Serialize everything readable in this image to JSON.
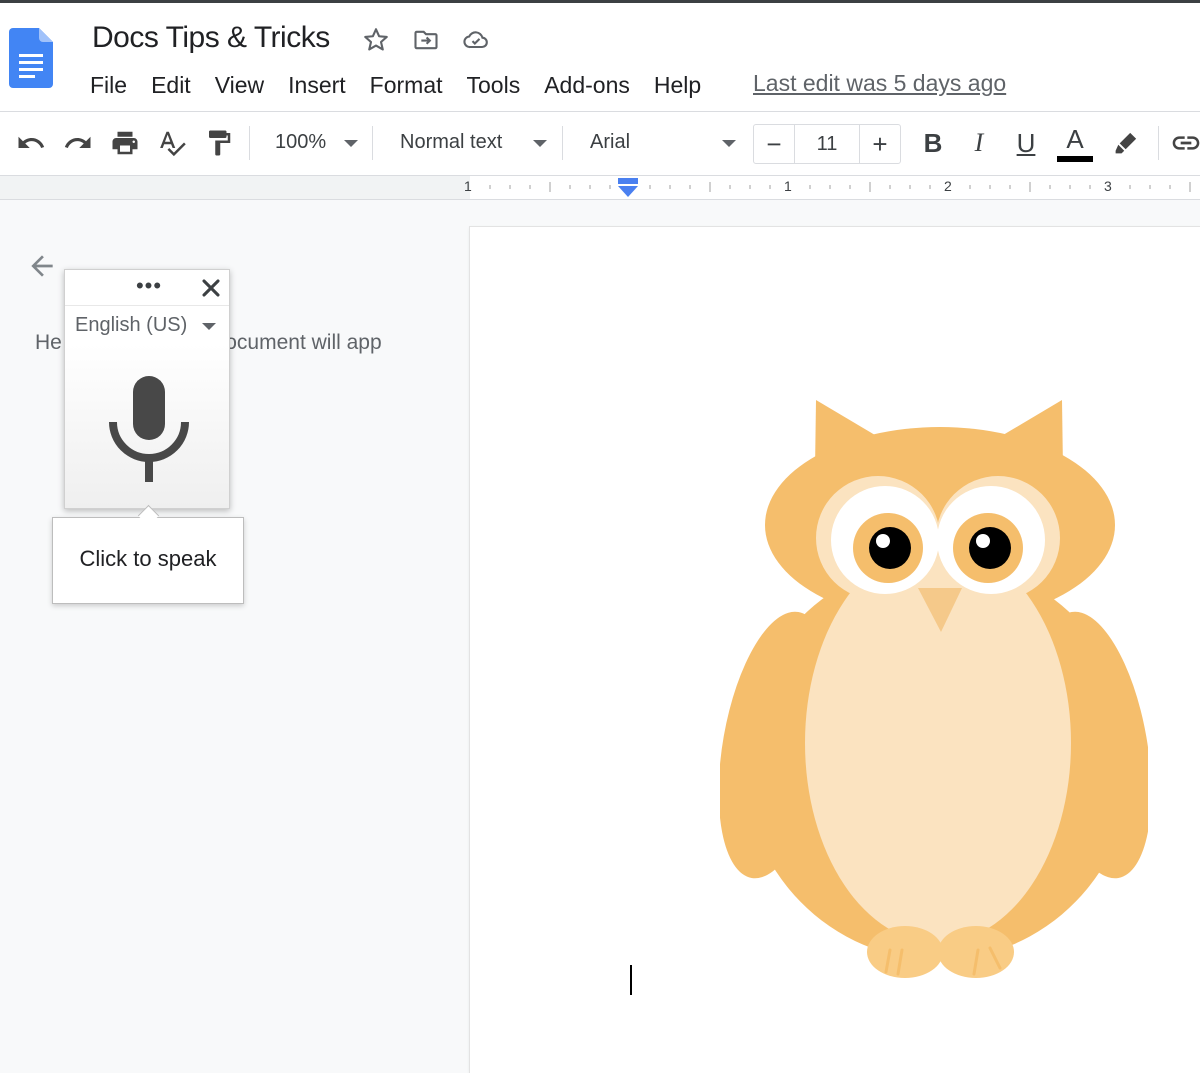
{
  "header": {
    "title": "Docs Tips & Tricks",
    "menu": [
      "File",
      "Edit",
      "View",
      "Insert",
      "Format",
      "Tools",
      "Add-ons",
      "Help"
    ],
    "last_edit": "Last edit was 5 days ago"
  },
  "toolbar": {
    "zoom": "100%",
    "style": "Normal text",
    "font": "Arial",
    "font_size": "11",
    "minus": "−",
    "plus": "+",
    "bold": "B",
    "italic": "I",
    "underline": "U",
    "text_color_glyph": "A"
  },
  "ruler": {
    "labels": [
      "1",
      "1",
      "2",
      "3"
    ]
  },
  "side_panel": {
    "text": "He                    the document will app"
  },
  "voice_typing": {
    "dots": "•••",
    "language": "English (US)",
    "tooltip": "Click to speak"
  },
  "colors": {
    "docs_blue": "#4285f4",
    "owl_orange": "#f5be6c",
    "owl_cream": "#fbe3c0",
    "text_color_bar": "#000000"
  }
}
